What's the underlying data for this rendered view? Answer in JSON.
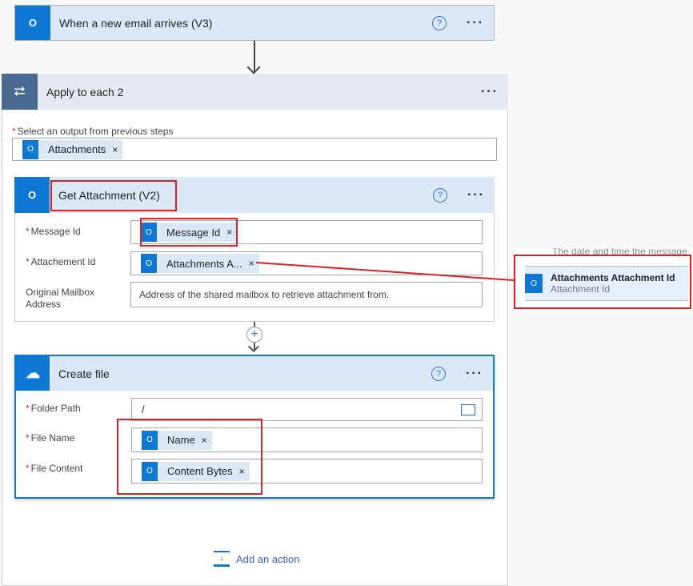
{
  "trigger": {
    "title": "When a new email arrives (V3)",
    "icon": "outlook-icon"
  },
  "loop": {
    "title": "Apply to each 2",
    "icon": "loop-icon",
    "select_label": "Select an output from previous steps",
    "select_token": "Attachments"
  },
  "get_attachment": {
    "title": "Get Attachment (V2)",
    "fields": [
      {
        "label": "Message Id",
        "token": "Message Id",
        "required": true
      },
      {
        "label": "Attachement Id",
        "token": "Attachments A...",
        "required": true
      },
      {
        "label": "Original Mailbox Address",
        "placeholder": "Address of the shared mailbox to retrieve attachment from.",
        "required": false
      }
    ]
  },
  "create_file": {
    "title": "Create file",
    "icon": "onedrive-icon",
    "fields": [
      {
        "label": "Folder Path",
        "value": "/",
        "required": true
      },
      {
        "label": "File Name",
        "token": "Name",
        "required": true
      },
      {
        "label": "File Content",
        "token": "Content Bytes",
        "required": true
      }
    ]
  },
  "add_action": "Add an action",
  "popup": {
    "clipped_text": "The date and time the message",
    "item_title": "Attachments Attachment Id",
    "item_subtitle": "Attachment Id"
  },
  "symbols": {
    "help": "?",
    "more": "···",
    "close": "×",
    "plus": "+",
    "required": "*"
  },
  "colors": {
    "accent": "#0f78d4",
    "header": "#dbe9f7",
    "loop": "#486991",
    "highlight": "#e02020"
  }
}
